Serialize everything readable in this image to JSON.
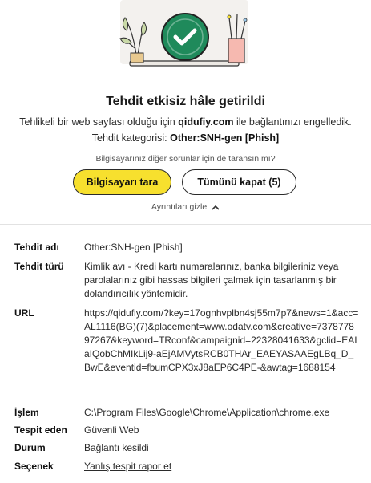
{
  "header": {
    "title": "Tehdit etkisiz hâle getirildi",
    "line1_prefix": "Tehlikeli bir web sayfası olduğu için",
    "domain": "qidufiy.com",
    "line1_suffix": "ile bağlantınızı engelledik.",
    "category_prefix": "Tehdit kategorisi:",
    "category_value": "Other:SNH-gen [Phish]",
    "question": "Bilgisayarınız diğer sorunlar için de taransın mı?"
  },
  "actions": {
    "scan_label": "Bilgisayarı tara",
    "close_all_label": "Tümünü kapat (5)",
    "hide_details_label": "Ayrıntıları gizle"
  },
  "details": [
    {
      "key": "Tehdit adı",
      "value": "Other:SNH-gen [Phish]"
    },
    {
      "key": "Tehdit türü",
      "value": "Kimlik avı - Kredi kartı numaralarınız, banka bilgileriniz veya parolalarınız gibi hassas bilgileri çalmak için tasarlanmış bir dolandırıcılık yöntemidir."
    },
    {
      "key": "URL",
      "value": "https://qidufiy.com/?key=17ognhvplbn4sj55m7p7&news=1&acc=AL1116(BG)(7)&placement=www.odatv.com&creative=737877897267&keyword=TRconf&campaignid=22328041633&gclid=EAIaIQobChMIkLij9-aEjAMVytsRCB0THAr_EAEYASAAEgLBq_D_BwE&eventid=fbumCPX3xJ8aEP6C4PE-&awtag=1688154"
    },
    {
      "key": "İşlem",
      "value": "C:\\Program Files\\Google\\Chrome\\Application\\chrome.exe"
    },
    {
      "key": "Tespit eden",
      "value": "Güvenli Web"
    },
    {
      "key": "Durum",
      "value": "Bağlantı kesildi"
    },
    {
      "key": "Seçenek",
      "value": "Yanlış tespit rapor et"
    }
  ],
  "colors": {
    "accent_yellow": "#f7e02e",
    "check_green": "#1f8a5b"
  }
}
